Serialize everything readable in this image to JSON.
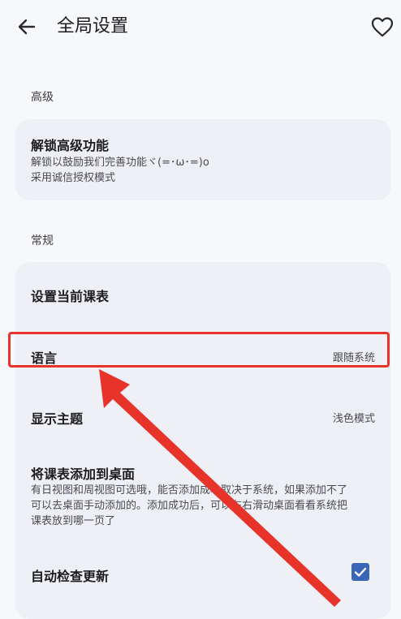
{
  "header": {
    "title": "全局设置",
    "back_icon": "arrow-left-icon",
    "favorite_icon": "heart-outline-icon"
  },
  "sections": [
    {
      "label": "高级",
      "items": [
        {
          "title": "解锁高级功能",
          "desc_line1": "解锁以鼓励我们完善功能ヾ(=･ω･=)o",
          "desc_line2": "采用诚信授权模式"
        }
      ]
    },
    {
      "label": "常规",
      "items": [
        {
          "title": "设置当前课表"
        },
        {
          "title": "语言",
          "value": "跟随系统"
        },
        {
          "title": "显示主题",
          "value": "浅色模式"
        },
        {
          "title": "将课表添加到桌面",
          "desc_line1": "有日视图和周视图可选哦，能否添加成功取决于系统，如果添加不了",
          "desc_line2": "可以去桌面手动添加的。添加成功后，可以左右滑动桌面看看系统把",
          "desc_line3": "课表放到哪一页了"
        },
        {
          "title": "自动检查更新",
          "checked": true
        }
      ]
    }
  ],
  "colors": {
    "background": "#f7f8fb",
    "card": "#eef0f5",
    "annotation": "#e8332a",
    "accent": "#3a66b8"
  }
}
